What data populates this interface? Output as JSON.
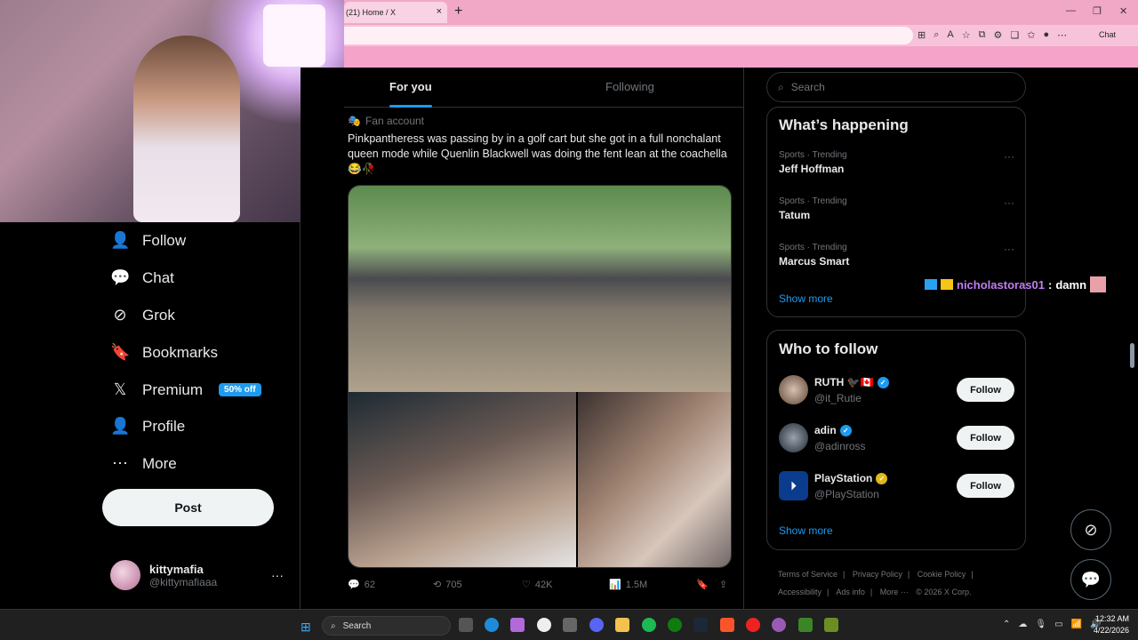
{
  "browser": {
    "tab_title": "(21) Home / X",
    "tab_close": "×",
    "new_tab": "+",
    "minimize": "—",
    "maximize": "❐",
    "close": "✕",
    "chat_label": "Chat"
  },
  "nav": {
    "items": [
      {
        "label": "Follow",
        "icon": "follow-icon",
        "glyph": "👤"
      },
      {
        "label": "Chat",
        "icon": "chat-icon",
        "glyph": "💬"
      },
      {
        "label": "Grok",
        "icon": "grok-icon",
        "glyph": "⊘"
      },
      {
        "label": "Bookmarks",
        "icon": "bookmark-icon",
        "glyph": "🔖"
      },
      {
        "label": "Premium",
        "icon": "x-logo-icon",
        "glyph": "𝕏"
      },
      {
        "label": "Profile",
        "icon": "profile-icon",
        "glyph": "👤"
      },
      {
        "label": "More",
        "icon": "more-icon",
        "glyph": "⋯"
      }
    ],
    "premium_badge": "50% off",
    "post_label": "Post"
  },
  "account": {
    "name": "kittymafia",
    "handle": "@kittymafiaaa",
    "more": "···"
  },
  "feed": {
    "tabs": [
      "For you",
      "Following"
    ],
    "tweet": {
      "source": "Fan account",
      "text": "Pinkpantheress was passing by in a golf cart but she got in a full nonchalant queen mode while Quenlin Blackwell was doing the fent lean at the coachella😂🥀",
      "replies": "62",
      "reposts": "705",
      "likes": "42K",
      "views": "1.5M"
    }
  },
  "sidebar": {
    "search_placeholder": "Search",
    "whats_happening_title": "What’s happening",
    "trends": [
      {
        "category": "Sports · Trending",
        "title": "Jeff Hoffman"
      },
      {
        "category": "Sports · Trending",
        "title": "Tatum"
      },
      {
        "category": "Sports · Trending",
        "title": "Marcus Smart"
      }
    ],
    "show_more": "Show more",
    "who_to_follow_title": "Who to follow",
    "follow_label": "Follow",
    "suggestions": [
      {
        "name": "RUTH 🐦‍⬛🇨🇦",
        "handle": "@it_Rutie",
        "verified": "blue"
      },
      {
        "name": "adin",
        "handle": "@adinross",
        "verified": "blue"
      },
      {
        "name": "PlayStation",
        "handle": "@PlayStation",
        "verified": "gold"
      }
    ],
    "footer": [
      "Terms of Service",
      "|",
      "Privacy Policy",
      "|",
      "Cookie Policy",
      "|",
      "Accessibility",
      "|",
      "Ads info",
      "|",
      "More ···",
      "© 2026 X Corp."
    ]
  },
  "stream_chat": {
    "user": "nicholastoras01",
    "sep": ":",
    "message": "damn"
  },
  "taskbar": {
    "search_label": "Search",
    "time": "12:32 AM",
    "date": "4/22/2026"
  },
  "colors": {
    "accent": "#1d9bf0",
    "browser_pink": "#f1a7c6",
    "chat_username": "#c27cf5"
  }
}
